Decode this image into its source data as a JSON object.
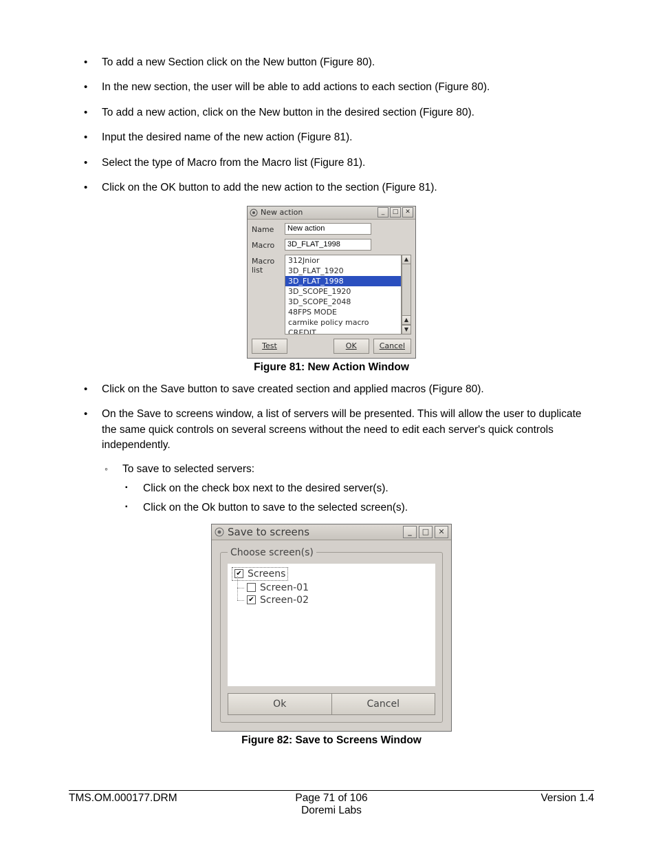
{
  "bullets_top": [
    "To add a new Section click on the New button (Figure 80).",
    "In the new section, the user will be able to add actions to each section (Figure 80).",
    "To add a new action, click on the New button in the desired section (Figure 80).",
    "Input the desired name of the new action (Figure 81).",
    "Select the type of Macro from the Macro list (Figure 81).",
    "Click on the OK button to add the new action to the section (Figure 81)."
  ],
  "fig81": {
    "title": "New action",
    "name_label": "Name",
    "name_value": "New action",
    "macro_label": "Macro",
    "macro_value": "3D_FLAT_1998",
    "list_label": "Macro list",
    "list": [
      "312Jnior",
      "3D_FLAT_1920",
      "3D_FLAT_1998",
      "3D_SCOPE_1920",
      "3D_SCOPE_2048",
      "48FPS MODE",
      "carmike policy macro",
      "CREDIT"
    ],
    "selected_index": 2,
    "btn_test": "Test",
    "btn_ok": "OK",
    "btn_cancel": "Cancel",
    "caption": "Figure 81: New Action Window"
  },
  "bullets_mid": [
    "Click on the Save button to save created section and applied macros (Figure 80).",
    "On the Save to screens window, a list of servers will be presented. This will allow the user to duplicate the same quick controls on several screens without the need to edit each server's quick controls independently."
  ],
  "sub2": "To save to selected servers:",
  "sub3": [
    "Click on the check box next to the desired server(s).",
    "Click on the Ok button to save to the selected screen(s)."
  ],
  "fig82": {
    "title": "Save to screens",
    "legend": "Choose screen(s)",
    "root": {
      "label": "Screens",
      "checked": true
    },
    "children": [
      {
        "label": "Screen-01",
        "checked": false
      },
      {
        "label": "Screen-02",
        "checked": true
      }
    ],
    "btn_ok": "Ok",
    "btn_cancel": "Cancel",
    "caption": "Figure 82: Save to Screens Window"
  },
  "footer": {
    "left": "TMS.OM.000177.DRM",
    "center_top": "Page 71 of 106",
    "center_bottom": "Doremi Labs",
    "right": "Version 1.4"
  }
}
